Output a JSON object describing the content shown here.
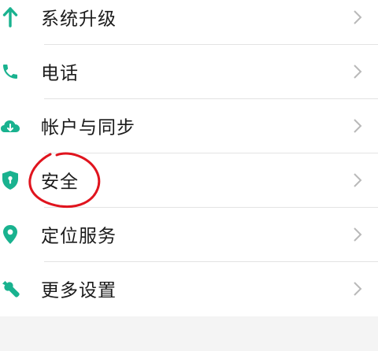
{
  "settings": {
    "items": [
      {
        "label": "系统升级",
        "icon": "arrow-up-icon"
      },
      {
        "label": "电话",
        "icon": "phone-icon"
      },
      {
        "label": "帐户与同步",
        "icon": "cloud-sync-icon"
      },
      {
        "label": "安全",
        "icon": "shield-lock-icon"
      },
      {
        "label": "定位服务",
        "icon": "location-pin-icon"
      },
      {
        "label": "更多设置",
        "icon": "wrench-icon"
      }
    ]
  },
  "colors": {
    "icon_accent": "#19b28f",
    "annotation_red": "#e0141e",
    "chevron": "#b9b9b9"
  }
}
